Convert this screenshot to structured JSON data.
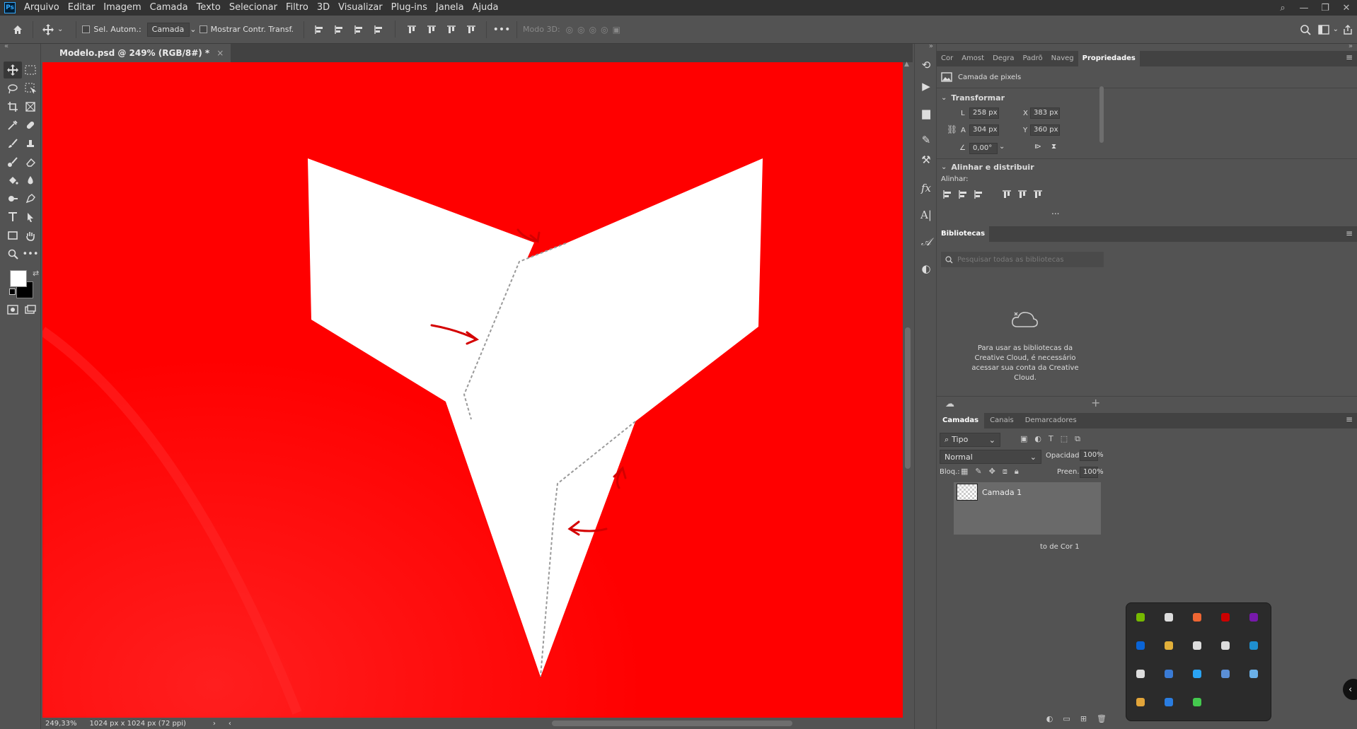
{
  "menubar": {
    "logo": "Ps",
    "items": [
      "Arquivo",
      "Editar",
      "Imagem",
      "Camada",
      "Texto",
      "Selecionar",
      "Filtro",
      "3D",
      "Visualizar",
      "Plug-ins",
      "Janela",
      "Ajuda"
    ]
  },
  "options": {
    "auto_select_label": "Sel. Autom.:",
    "auto_select_value": "Camada",
    "show_transform_label": "Mostrar Contr. Transf.",
    "mode3d_label": "Modo 3D:"
  },
  "document": {
    "tab_title": "Modelo.psd @ 249% (RGB/8#) *",
    "zoom": "249,33%",
    "doc_info": "1024 px x 1024 px (72 ppi)",
    "canvas_color": "#ff0000"
  },
  "properties": {
    "tabs": [
      "Cor",
      "Amost",
      "Degra",
      "Padrõ",
      "Naveg",
      "Propriedades"
    ],
    "layer_type": "Camada de pixels",
    "transform_title": "Transformar",
    "w_label": "L",
    "w_value": "258 px",
    "h_label": "A",
    "h_value": "304 px",
    "x_label": "X",
    "x_value": "383 px",
    "y_label": "Y",
    "y_value": "360 px",
    "angle": "0,00°",
    "align_title": "Alinhar e distribuir",
    "align_label": "Alinhar:",
    "more": "..."
  },
  "libraries": {
    "title": "Bibliotecas",
    "search_placeholder": "Pesquisar todas as bibliotecas",
    "message": "Para usar as bibliotecas da Creative Cloud, é necessário acessar sua conta da Creative Cloud."
  },
  "layers": {
    "tabs": [
      "Camadas",
      "Canais",
      "Demarcadores"
    ],
    "filter": "Tipo",
    "blend_mode": "Normal",
    "opacity_label": "Opacidade:",
    "opacity": "100%",
    "lock_label": "Bloq.:",
    "fill_label": "Preen.:",
    "fill": "100%",
    "layer1": "Camada 1",
    "layer_partial": "to de Cor 1"
  },
  "tray": {
    "icons": [
      "nvidia-icon",
      "t-app-icon",
      "color-wheel-icon",
      "adobe-icon",
      "onenote-icon",
      "outlook-icon",
      "photos-icon",
      "creative-cloud-icon",
      "usb-icon",
      "steam-client-icon",
      "tools-icon",
      "app-blue-icon",
      "orb-icon",
      "app-dark-icon",
      "steam-icon",
      "gpu-icon",
      "bluetooth-icon",
      "fan-icon"
    ]
  },
  "colors": {
    "canvas_red": "#ff0000",
    "ui_dark": "#323232",
    "ui_mid": "#535353",
    "annotation": "#d40000"
  }
}
